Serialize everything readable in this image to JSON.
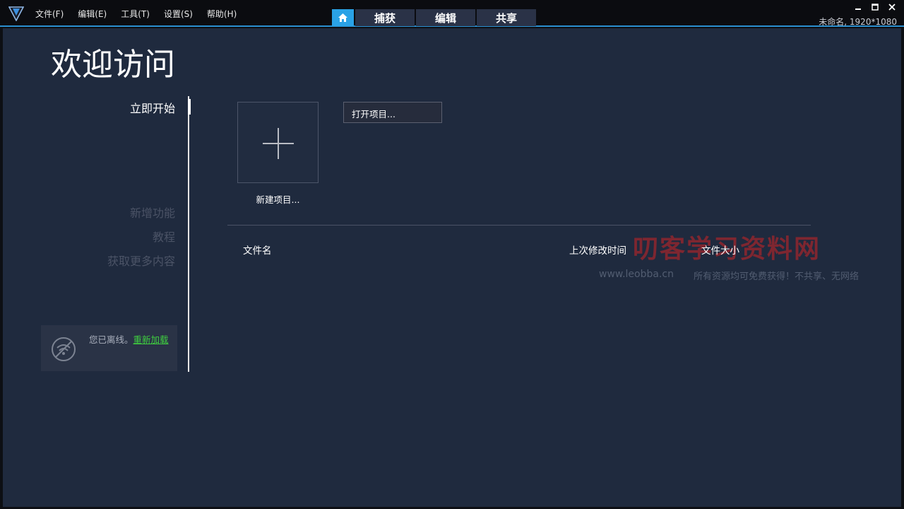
{
  "menu": [
    {
      "label": "文件(F)"
    },
    {
      "label": "编辑(E)"
    },
    {
      "label": "工具(T)"
    },
    {
      "label": "设置(S)"
    },
    {
      "label": "帮助(H)"
    }
  ],
  "tabs": [
    {
      "label": "捕获"
    },
    {
      "label": "编辑"
    },
    {
      "label": "共享"
    }
  ],
  "project_info": "未命名, 1920*1080",
  "page_title": "欢迎访问",
  "side_nav": {
    "get_started": "立即开始",
    "whats_new": "新增功能",
    "tutorials": "教程",
    "get_more": "获取更多内容"
  },
  "offline": {
    "message": "您已离线。",
    "reload": "重新加载"
  },
  "new_project_label": "新建项目...",
  "open_project_label": "打开项目...",
  "file_list": {
    "columns": [
      "文件名",
      "上次修改时间",
      "文件大小"
    ]
  },
  "watermark": {
    "title": "叨客学习资料网",
    "url": "www.leobba.cn",
    "note": "所有资源均可免费获得！不共享、无网络"
  },
  "colors": {
    "accent": "#2aa2e6",
    "background": "#1f2a3e",
    "link": "#3fcf3f"
  }
}
